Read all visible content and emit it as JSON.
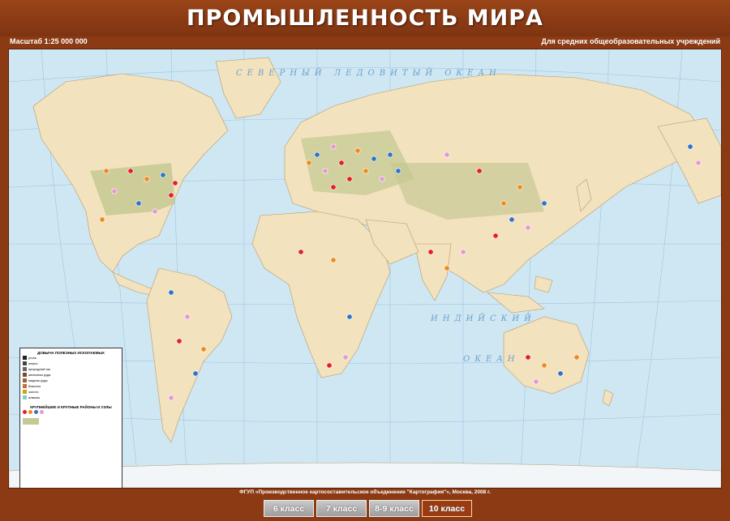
{
  "header": {
    "title": "ПРОМЫШЛЕННОСТЬ МИРА"
  },
  "meta": {
    "scale": "Масштаб 1:25 000 000",
    "audience": "Для средних общеобразовательных учреждений"
  },
  "map": {
    "ocean_labels": [
      "СЕВЕРНЫЙ ЛЕДОВИТЫЙ ОКЕАН",
      "ИНДИЙСКИЙ",
      "ОКЕАН"
    ],
    "colors": {
      "ocean": "#cfe7f3",
      "land": "#f3e2be",
      "industrial_zone": "#c6c994",
      "center_red": "#e2202a",
      "center_orange": "#f08a1c",
      "center_blue": "#2f74c9",
      "center_pink": "#e59ad0"
    }
  },
  "legend": {
    "title": "ДОБЫЧА ПОЛЕЗНЫХ ИСКОПАЕМЫХ",
    "subtitle": "КРУПНЕЙШИЕ И КРУПНЫЕ РАЙОНЫ И УЗЛЫ",
    "items": [
      "уголь",
      "нефть",
      "природный газ",
      "железная руда",
      "медная руда",
      "бокситы",
      "золото",
      "алмазы"
    ]
  },
  "footer": {
    "publisher": "ФГУП «Производственное картосоставительское объединение \"Картография\"», Москва, 2008 г.",
    "grades": [
      "6 класс",
      "7 класс",
      "8-9 класс",
      "10 класс"
    ],
    "active_grade": "10 класс"
  }
}
